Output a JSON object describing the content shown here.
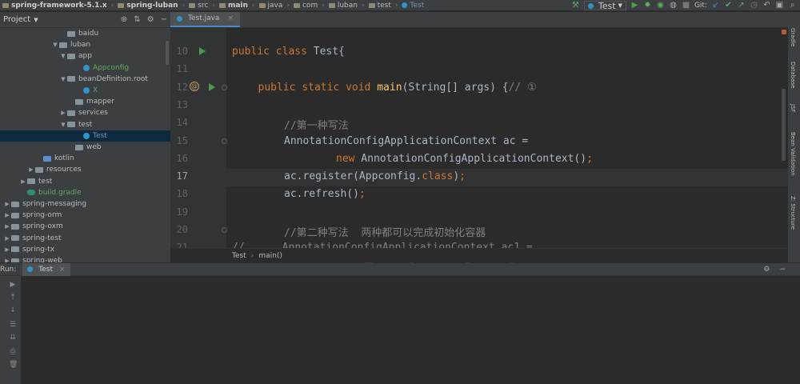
{
  "breadcrumb": [
    {
      "label": "spring-framework-5.1.x",
      "bold": true,
      "icon": "folder-icon"
    },
    {
      "label": "spring-luban",
      "bold": true,
      "icon": "folder-icon"
    },
    {
      "label": "src",
      "bold": false,
      "icon": "folder-icon"
    },
    {
      "label": "main",
      "bold": true,
      "icon": "folder-icon"
    },
    {
      "label": "java",
      "bold": false,
      "icon": "folder-icon"
    },
    {
      "label": "com",
      "bold": false,
      "icon": "folder-icon"
    },
    {
      "label": "luban",
      "bold": false,
      "icon": "folder-icon"
    },
    {
      "label": "test",
      "bold": false,
      "icon": "folder-icon"
    },
    {
      "label": "Test",
      "bold": false,
      "icon": "class-icon"
    }
  ],
  "toolbar": {
    "run_config": "Test",
    "git_label": "Git:"
  },
  "project_panel": {
    "title": "Project",
    "tree": [
      {
        "label": "baidu",
        "indent": 7,
        "arrow": "",
        "icon": "package",
        "color": ""
      },
      {
        "label": "luban",
        "indent": 6,
        "arrow": "▼",
        "icon": "package",
        "color": ""
      },
      {
        "label": "app",
        "indent": 7,
        "arrow": "▼",
        "icon": "package",
        "color": ""
      },
      {
        "label": "Appconfig",
        "indent": 9,
        "arrow": "",
        "icon": "class",
        "color": "green"
      },
      {
        "label": "beanDefinition.root",
        "indent": 7,
        "arrow": "▼",
        "icon": "package",
        "color": ""
      },
      {
        "label": "X",
        "indent": 9,
        "arrow": "",
        "icon": "class",
        "color": "green"
      },
      {
        "label": "mapper",
        "indent": 8,
        "arrow": "",
        "icon": "package",
        "color": ""
      },
      {
        "label": "services",
        "indent": 7,
        "arrow": "▶",
        "icon": "package",
        "color": ""
      },
      {
        "label": "test",
        "indent": 7,
        "arrow": "▼",
        "icon": "package",
        "color": ""
      },
      {
        "label": "Test",
        "indent": 9,
        "arrow": "",
        "icon": "class",
        "color": "blue",
        "selected": true
      },
      {
        "label": "web",
        "indent": 8,
        "arrow": "",
        "icon": "package",
        "color": ""
      },
      {
        "label": "kotlin",
        "indent": 4,
        "arrow": "",
        "icon": "folder-blue",
        "color": ""
      },
      {
        "label": "resources",
        "indent": 3,
        "arrow": "▶",
        "icon": "folder",
        "color": ""
      },
      {
        "label": "test",
        "indent": 2,
        "arrow": "▶",
        "icon": "folder",
        "color": ""
      },
      {
        "label": "build.gradle",
        "indent": 2,
        "arrow": "",
        "icon": "gradle",
        "color": "green"
      },
      {
        "label": "spring-messaging",
        "indent": 0,
        "arrow": "▶",
        "icon": "folder",
        "color": ""
      },
      {
        "label": "spring-orm",
        "indent": 0,
        "arrow": "▶",
        "icon": "folder",
        "color": ""
      },
      {
        "label": "spring-oxm",
        "indent": 0,
        "arrow": "▶",
        "icon": "folder",
        "color": ""
      },
      {
        "label": "spring-test",
        "indent": 0,
        "arrow": "▶",
        "icon": "folder",
        "color": ""
      },
      {
        "label": "spring-tx",
        "indent": 0,
        "arrow": "▶",
        "icon": "folder",
        "color": ""
      },
      {
        "label": "spring-web",
        "indent": 0,
        "arrow": "▶",
        "icon": "folder",
        "color": ""
      }
    ]
  },
  "editor": {
    "tab_label": "Test.java",
    "lines": [
      {
        "n": "10",
        "html": "<span class=\"kw\">public class</span> Test{",
        "indent": 0
      },
      {
        "n": "11",
        "html": "",
        "indent": 0
      },
      {
        "n": "12",
        "html": "<span class=\"kw\">public static void</span> <span class=\"fn\">main</span>(String[] args) {<span class=\"cm\">// ①</span>",
        "indent": 1
      },
      {
        "n": "13",
        "html": "",
        "indent": 0
      },
      {
        "n": "14",
        "html": "<span class=\"cm\">//第一种写法</span>",
        "indent": 2
      },
      {
        "n": "15",
        "html": "AnnotationConfigApplicationContext ac =",
        "indent": 2
      },
      {
        "n": "16",
        "html": "<span class=\"kw\">new</span> AnnotationConfigApplicationContext()<span class=\"kw\">;</span>",
        "indent": 4
      },
      {
        "n": "17",
        "html": "ac.register(Appconfig.<span class=\"kw\">class</span>)<span class=\"kw\">;</span>",
        "indent": 2
      },
      {
        "n": "18",
        "html": "ac.refresh()<span class=\"kw\">;</span>",
        "indent": 2
      },
      {
        "n": "19",
        "html": "",
        "indent": 0
      },
      {
        "n": "20",
        "html": "<span class=\"cm\">//第二种写法  两种都可以完成初始化容器</span>",
        "indent": 2
      },
      {
        "n": "21",
        "html": "<span class=\"cm\">//      AnnotationConfigApplicationContext ac1 =</span>",
        "indent": 0
      }
    ],
    "crumb": [
      "Test",
      "main()"
    ]
  },
  "right_strip": [
    "Gradle",
    "Database",
    "JSF",
    "Bean Validation",
    "Z: Structure"
  ],
  "run_panel": {
    "label": "Run:",
    "tab": "Test"
  }
}
